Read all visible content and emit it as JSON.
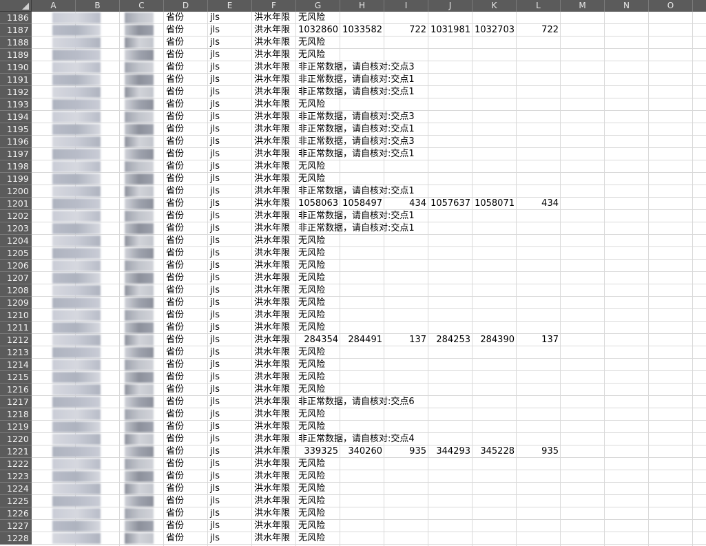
{
  "columns": [
    "A",
    "B",
    "C",
    "D",
    "E",
    "F",
    "G",
    "H",
    "I",
    "J",
    "K",
    "L",
    "M",
    "N",
    "O"
  ],
  "rows": [
    {
      "n": "1186",
      "d": "省份",
      "e": "jls",
      "f": "洪水年限",
      "g": "无风险"
    },
    {
      "n": "1187",
      "d": "省份",
      "e": "jls",
      "f": "洪水年限",
      "g": "1032860",
      "h": "1033582",
      "i": "722",
      "j": "1031981",
      "k": "1032703",
      "l": "722"
    },
    {
      "n": "1188",
      "d": "省份",
      "e": "jls",
      "f": "洪水年限",
      "g": "无风险"
    },
    {
      "n": "1189",
      "d": "省份",
      "e": "jls",
      "f": "洪水年限",
      "g": "无风险"
    },
    {
      "n": "1190",
      "d": "省份",
      "e": "jls",
      "f": "洪水年限",
      "g": "非正常数据，请自核对:交点3"
    },
    {
      "n": "1191",
      "d": "省份",
      "e": "jls",
      "f": "洪水年限",
      "g": "非正常数据，请自核对:交点1"
    },
    {
      "n": "1192",
      "d": "省份",
      "e": "jls",
      "f": "洪水年限",
      "g": "非正常数据，请自核对:交点1"
    },
    {
      "n": "1193",
      "d": "省份",
      "e": "jls",
      "f": "洪水年限",
      "g": "无风险"
    },
    {
      "n": "1194",
      "d": "省份",
      "e": "jls",
      "f": "洪水年限",
      "g": "非正常数据，请自核对:交点3"
    },
    {
      "n": "1195",
      "d": "省份",
      "e": "jls",
      "f": "洪水年限",
      "g": "非正常数据，请自核对:交点1"
    },
    {
      "n": "1196",
      "d": "省份",
      "e": "jls",
      "f": "洪水年限",
      "g": "非正常数据，请自核对:交点3"
    },
    {
      "n": "1197",
      "d": "省份",
      "e": "jls",
      "f": "洪水年限",
      "g": "非正常数据，请自核对:交点1"
    },
    {
      "n": "1198",
      "d": "省份",
      "e": "jls",
      "f": "洪水年限",
      "g": "无风险"
    },
    {
      "n": "1199",
      "d": "省份",
      "e": "jls",
      "f": "洪水年限",
      "g": "无风险"
    },
    {
      "n": "1200",
      "d": "省份",
      "e": "jls",
      "f": "洪水年限",
      "g": "非正常数据，请自核对:交点1"
    },
    {
      "n": "1201",
      "d": "省份",
      "e": "jls",
      "f": "洪水年限",
      "g": "1058063",
      "h": "1058497",
      "i": "434",
      "j": "1057637",
      "k": "1058071",
      "l": "434"
    },
    {
      "n": "1202",
      "d": "省份",
      "e": "jls",
      "f": "洪水年限",
      "g": "非正常数据，请自核对:交点1"
    },
    {
      "n": "1203",
      "d": "省份",
      "e": "jls",
      "f": "洪水年限",
      "g": "非正常数据，请自核对:交点1"
    },
    {
      "n": "1204",
      "d": "省份",
      "e": "jls",
      "f": "洪水年限",
      "g": "无风险"
    },
    {
      "n": "1205",
      "d": "省份",
      "e": "jls",
      "f": "洪水年限",
      "g": "无风险"
    },
    {
      "n": "1206",
      "d": "省份",
      "e": "jls",
      "f": "洪水年限",
      "g": "无风险"
    },
    {
      "n": "1207",
      "d": "省份",
      "e": "jls",
      "f": "洪水年限",
      "g": "无风险"
    },
    {
      "n": "1208",
      "d": "省份",
      "e": "jls",
      "f": "洪水年限",
      "g": "无风险"
    },
    {
      "n": "1209",
      "d": "省份",
      "e": "jls",
      "f": "洪水年限",
      "g": "无风险"
    },
    {
      "n": "1210",
      "d": "省份",
      "e": "jls",
      "f": "洪水年限",
      "g": "无风险"
    },
    {
      "n": "1211",
      "d": "省份",
      "e": "jls",
      "f": "洪水年限",
      "g": "无风险"
    },
    {
      "n": "1212",
      "d": "省份",
      "e": "jls",
      "f": "洪水年限",
      "g": "284354",
      "h": "284491",
      "i": "137",
      "j": "284253",
      "k": "284390",
      "l": "137"
    },
    {
      "n": "1213",
      "d": "省份",
      "e": "jls",
      "f": "洪水年限",
      "g": "无风险"
    },
    {
      "n": "1214",
      "d": "省份",
      "e": "jls",
      "f": "洪水年限",
      "g": "无风险"
    },
    {
      "n": "1215",
      "d": "省份",
      "e": "jls",
      "f": "洪水年限",
      "g": "无风险"
    },
    {
      "n": "1216",
      "d": "省份",
      "e": "jls",
      "f": "洪水年限",
      "g": "无风险"
    },
    {
      "n": "1217",
      "d": "省份",
      "e": "jls",
      "f": "洪水年限",
      "g": "非正常数据，请自核对:交点6"
    },
    {
      "n": "1218",
      "d": "省份",
      "e": "jls",
      "f": "洪水年限",
      "g": "无风险"
    },
    {
      "n": "1219",
      "d": "省份",
      "e": "jls",
      "f": "洪水年限",
      "g": "无风险"
    },
    {
      "n": "1220",
      "d": "省份",
      "e": "jls",
      "f": "洪水年限",
      "g": "非正常数据，请自核对:交点4"
    },
    {
      "n": "1221",
      "d": "省份",
      "e": "jls",
      "f": "洪水年限",
      "g": "339325",
      "h": "340260",
      "i": "935",
      "j": "344293",
      "k": "345228",
      "l": "935"
    },
    {
      "n": "1222",
      "d": "省份",
      "e": "jls",
      "f": "洪水年限",
      "g": "无风险"
    },
    {
      "n": "1223",
      "d": "省份",
      "e": "jls",
      "f": "洪水年限",
      "g": "无风险"
    },
    {
      "n": "1224",
      "d": "省份",
      "e": "jls",
      "f": "洪水年限",
      "g": "无风险"
    },
    {
      "n": "1225",
      "d": "省份",
      "e": "jls",
      "f": "洪水年限",
      "g": "无风险"
    },
    {
      "n": "1226",
      "d": "省份",
      "e": "jls",
      "f": "洪水年限",
      "g": "无风险"
    },
    {
      "n": "1227",
      "d": "省份",
      "e": "jls",
      "f": "洪水年限",
      "g": "无风险"
    },
    {
      "n": "1228",
      "d": "省份",
      "e": "jls",
      "f": "洪水年限",
      "g": "无风险"
    }
  ],
  "colors": {
    "header_bg": "#5b5b5b",
    "header_text": "#e8e8e8",
    "gridline": "#d9d9d9"
  }
}
